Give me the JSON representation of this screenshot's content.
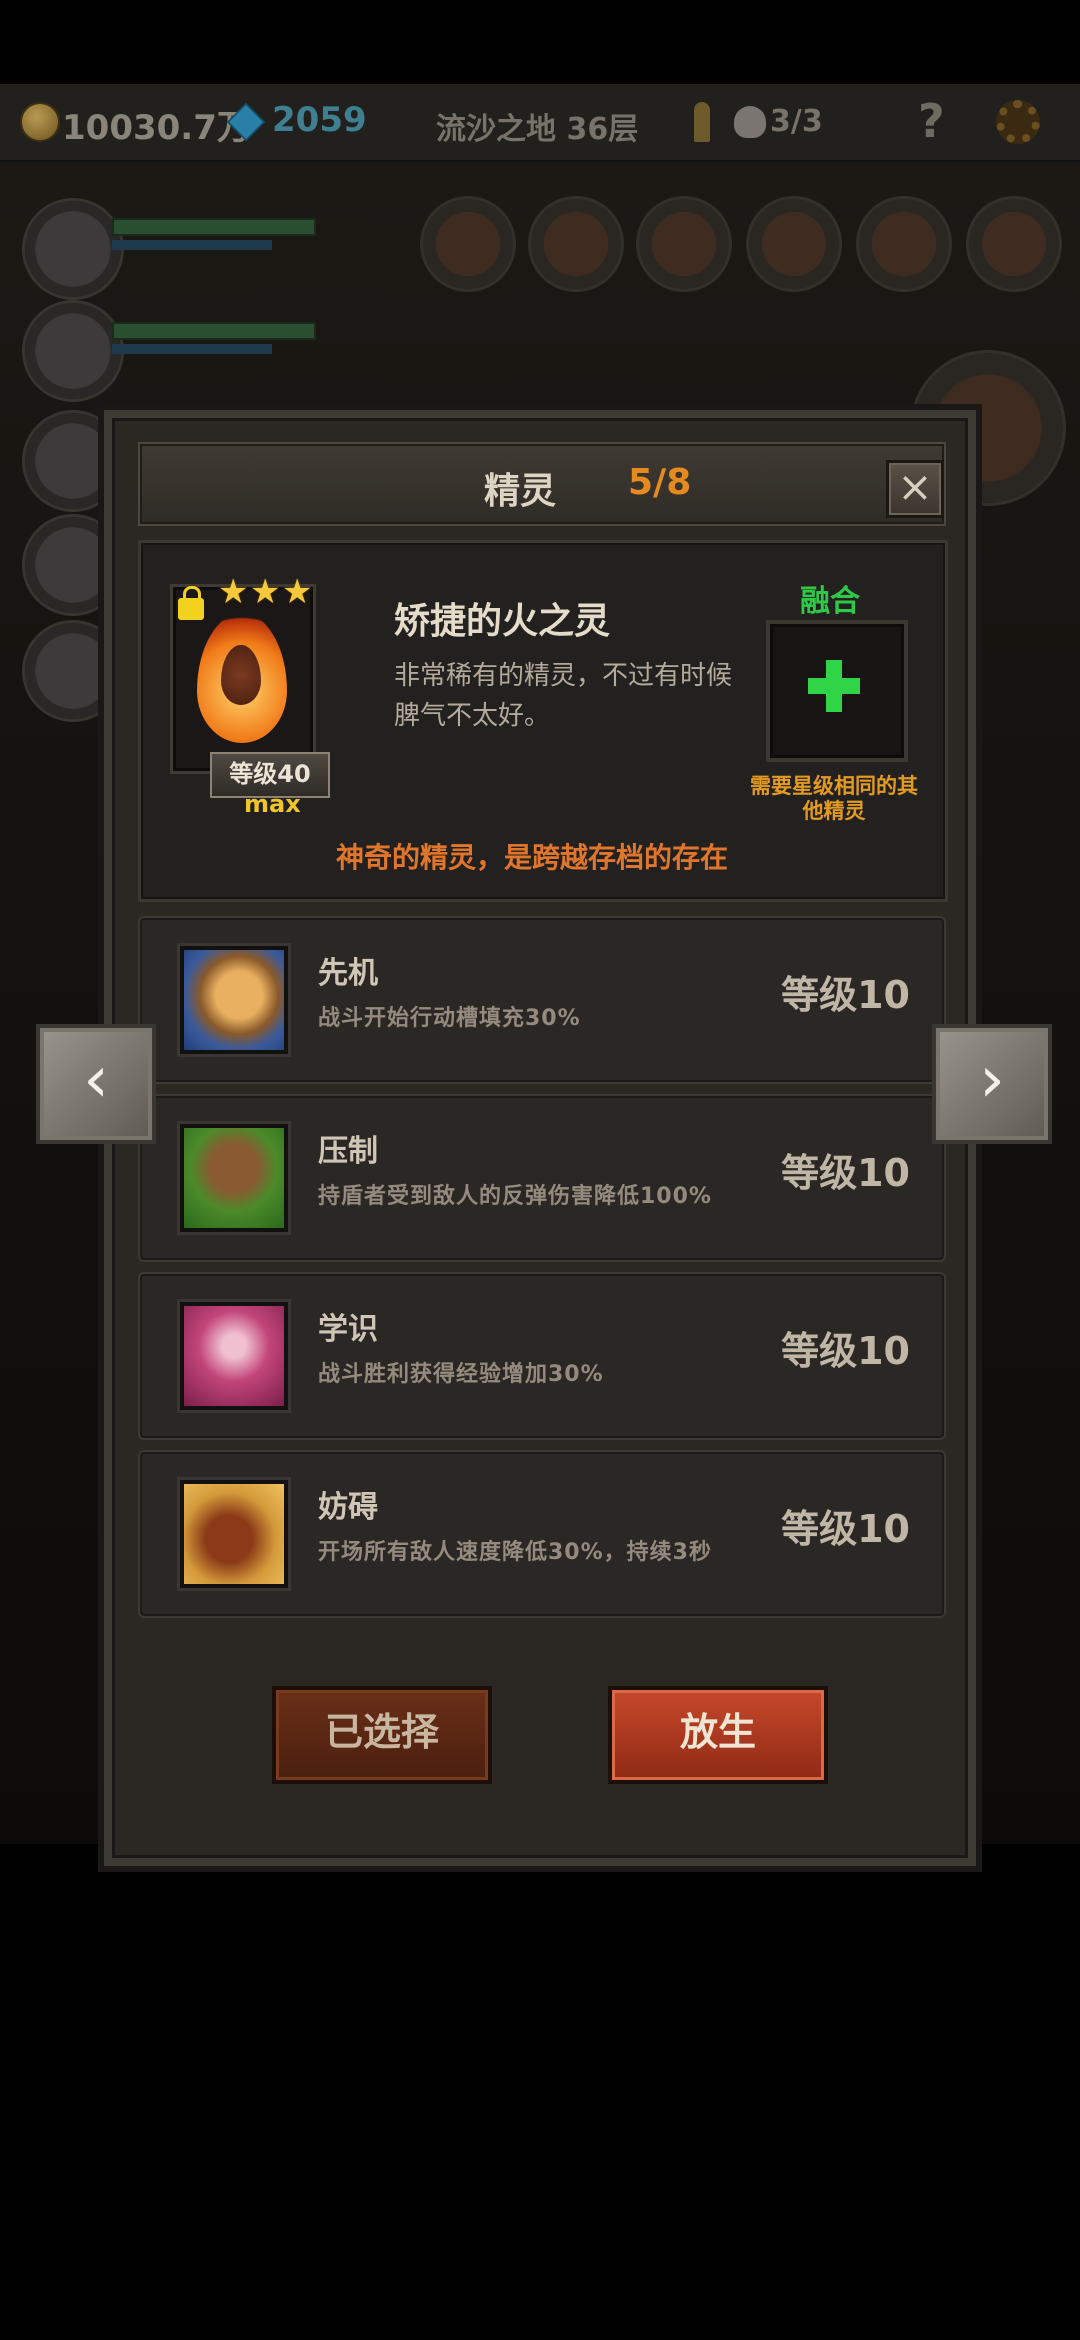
{
  "topbar": {
    "gold": "10030.7万",
    "gems": "2059",
    "stage": "流沙之地 36层",
    "skulls": "3/3",
    "help": "?"
  },
  "dialog": {
    "title": "精灵",
    "count": "5/8",
    "close": "×"
  },
  "spirit": {
    "stars": 3,
    "level": "等级40",
    "max": "max",
    "name": "矫捷的火之灵",
    "description": "非常稀有的精灵，不过有时候脾气不太好。",
    "tagline": "神奇的精灵，是跨越存档的存在",
    "locked": true
  },
  "fusion": {
    "label": "融合",
    "note": "需要星级相同的其他精灵"
  },
  "skills": [
    {
      "name": "先机",
      "desc": "战斗开始行动槽填充30%",
      "level": "等级10",
      "icon": "leopard-icon"
    },
    {
      "name": "压制",
      "desc": "持盾者受到敌人的反弹伤害降低100%",
      "level": "等级10",
      "icon": "beast-claw-icon"
    },
    {
      "name": "学识",
      "desc": "战斗胜利获得经验增加30%",
      "level": "等级10",
      "icon": "wise-face-icon"
    },
    {
      "name": "妨碍",
      "desc": "开场所有敌人速度降低30%，持续3秒",
      "level": "等级10",
      "icon": "chained-boot-icon"
    }
  ],
  "buttons": {
    "selected": "已选择",
    "release": "放生"
  },
  "nav": {
    "prev": "‹",
    "next": "›"
  }
}
